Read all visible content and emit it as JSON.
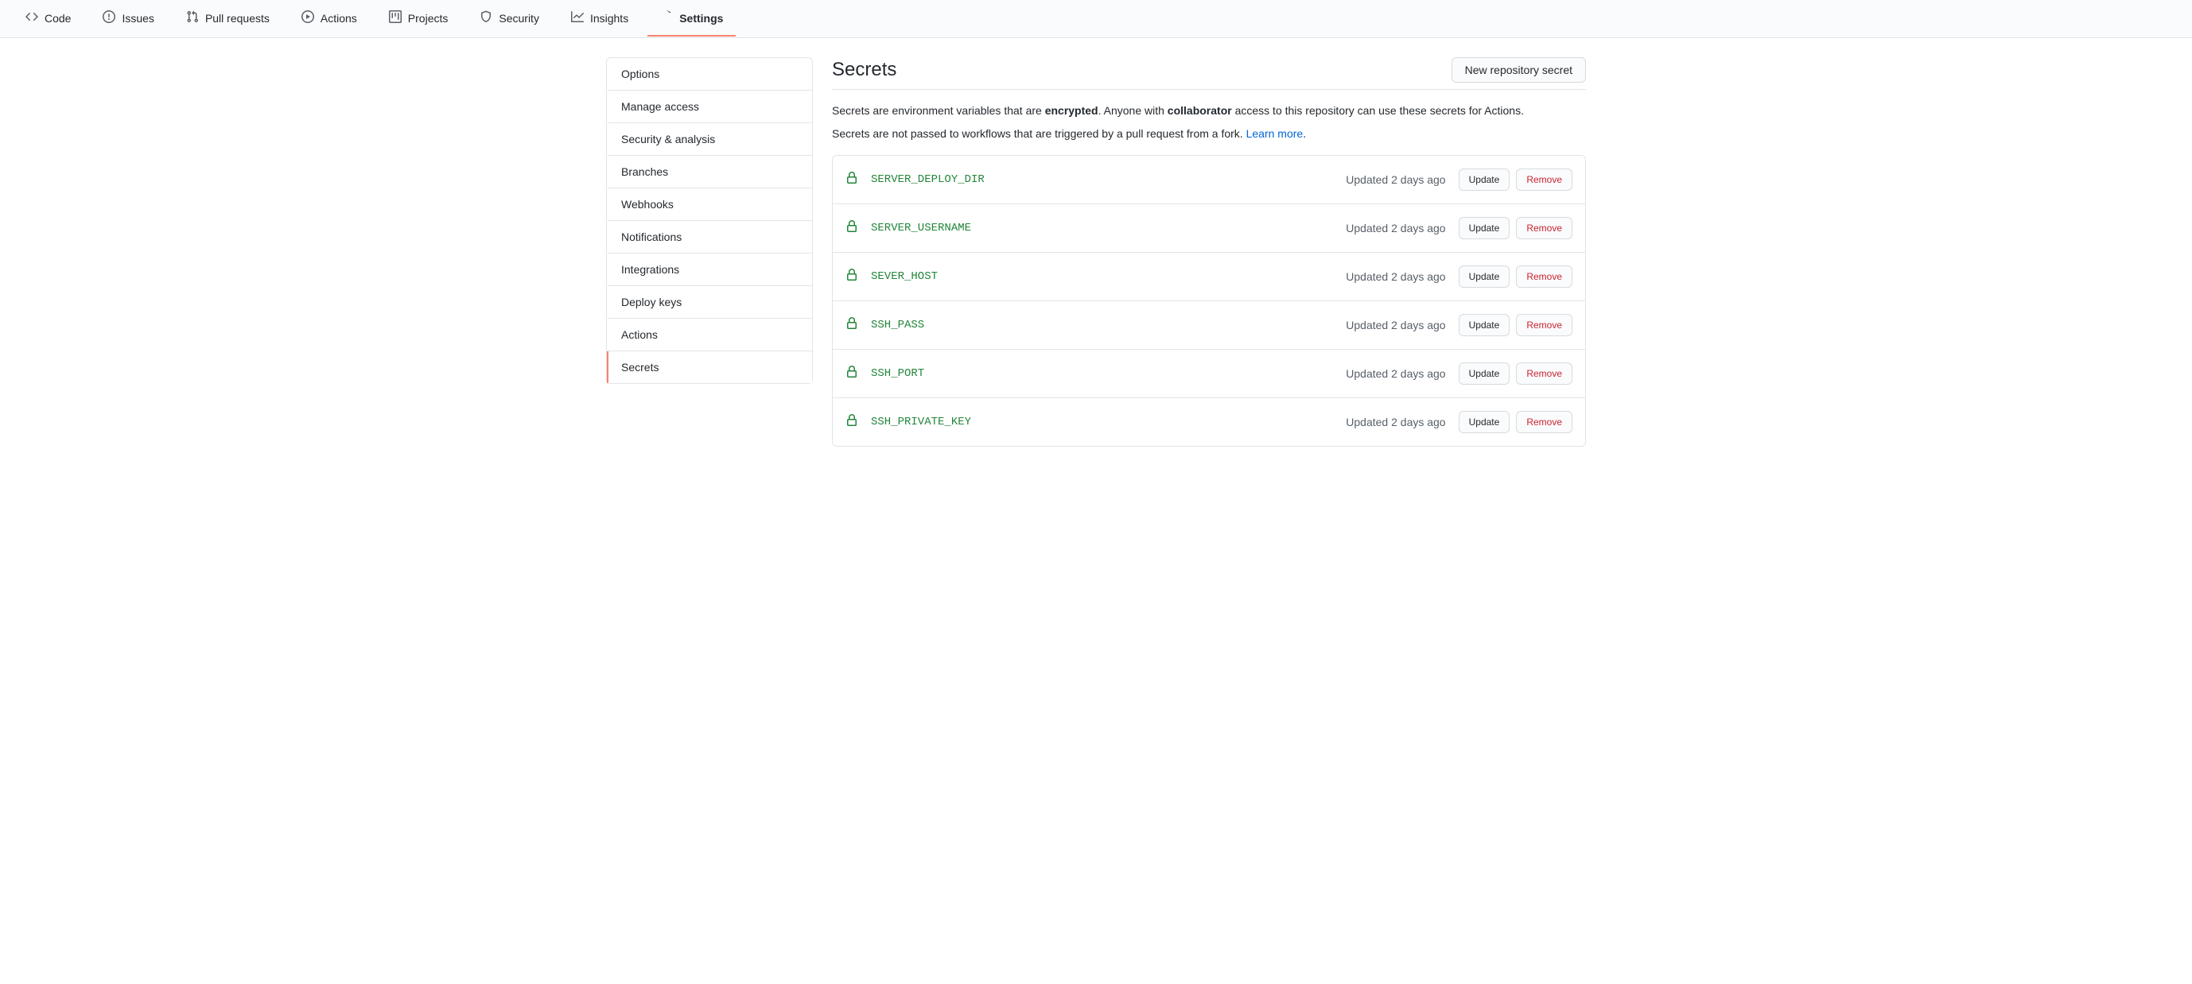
{
  "repoNav": [
    {
      "label": "Code",
      "icon": "code"
    },
    {
      "label": "Issues",
      "icon": "issue"
    },
    {
      "label": "Pull requests",
      "icon": "pr"
    },
    {
      "label": "Actions",
      "icon": "play"
    },
    {
      "label": "Projects",
      "icon": "project"
    },
    {
      "label": "Security",
      "icon": "shield"
    },
    {
      "label": "Insights",
      "icon": "graph"
    },
    {
      "label": "Settings",
      "icon": "gear",
      "active": true
    }
  ],
  "sidebar": {
    "items": [
      {
        "label": "Options"
      },
      {
        "label": "Manage access"
      },
      {
        "label": "Security & analysis"
      },
      {
        "label": "Branches"
      },
      {
        "label": "Webhooks"
      },
      {
        "label": "Notifications"
      },
      {
        "label": "Integrations"
      },
      {
        "label": "Deploy keys"
      },
      {
        "label": "Actions"
      },
      {
        "label": "Secrets",
        "active": true
      }
    ]
  },
  "page": {
    "title": "Secrets",
    "newButton": "New repository secret",
    "desc1_a": "Secrets are environment variables that are ",
    "desc1_b": "encrypted",
    "desc1_c": ". Anyone with ",
    "desc1_d": "collaborator",
    "desc1_e": " access to this repository can use these secrets for Actions.",
    "desc2_a": "Secrets are not passed to workflows that are triggered by a pull request from a fork. ",
    "desc2_link": "Learn more",
    "desc2_b": "."
  },
  "secrets": [
    {
      "name": "SERVER_DEPLOY_DIR",
      "updated": "Updated 2 days ago"
    },
    {
      "name": "SERVER_USERNAME",
      "updated": "Updated 2 days ago"
    },
    {
      "name": "SEVER_HOST",
      "updated": "Updated 2 days ago"
    },
    {
      "name": "SSH_PASS",
      "updated": "Updated 2 days ago"
    },
    {
      "name": "SSH_PORT",
      "updated": "Updated 2 days ago"
    },
    {
      "name": "SSH_PRIVATE_KEY",
      "updated": "Updated 2 days ago"
    }
  ],
  "labels": {
    "update": "Update",
    "remove": "Remove"
  }
}
